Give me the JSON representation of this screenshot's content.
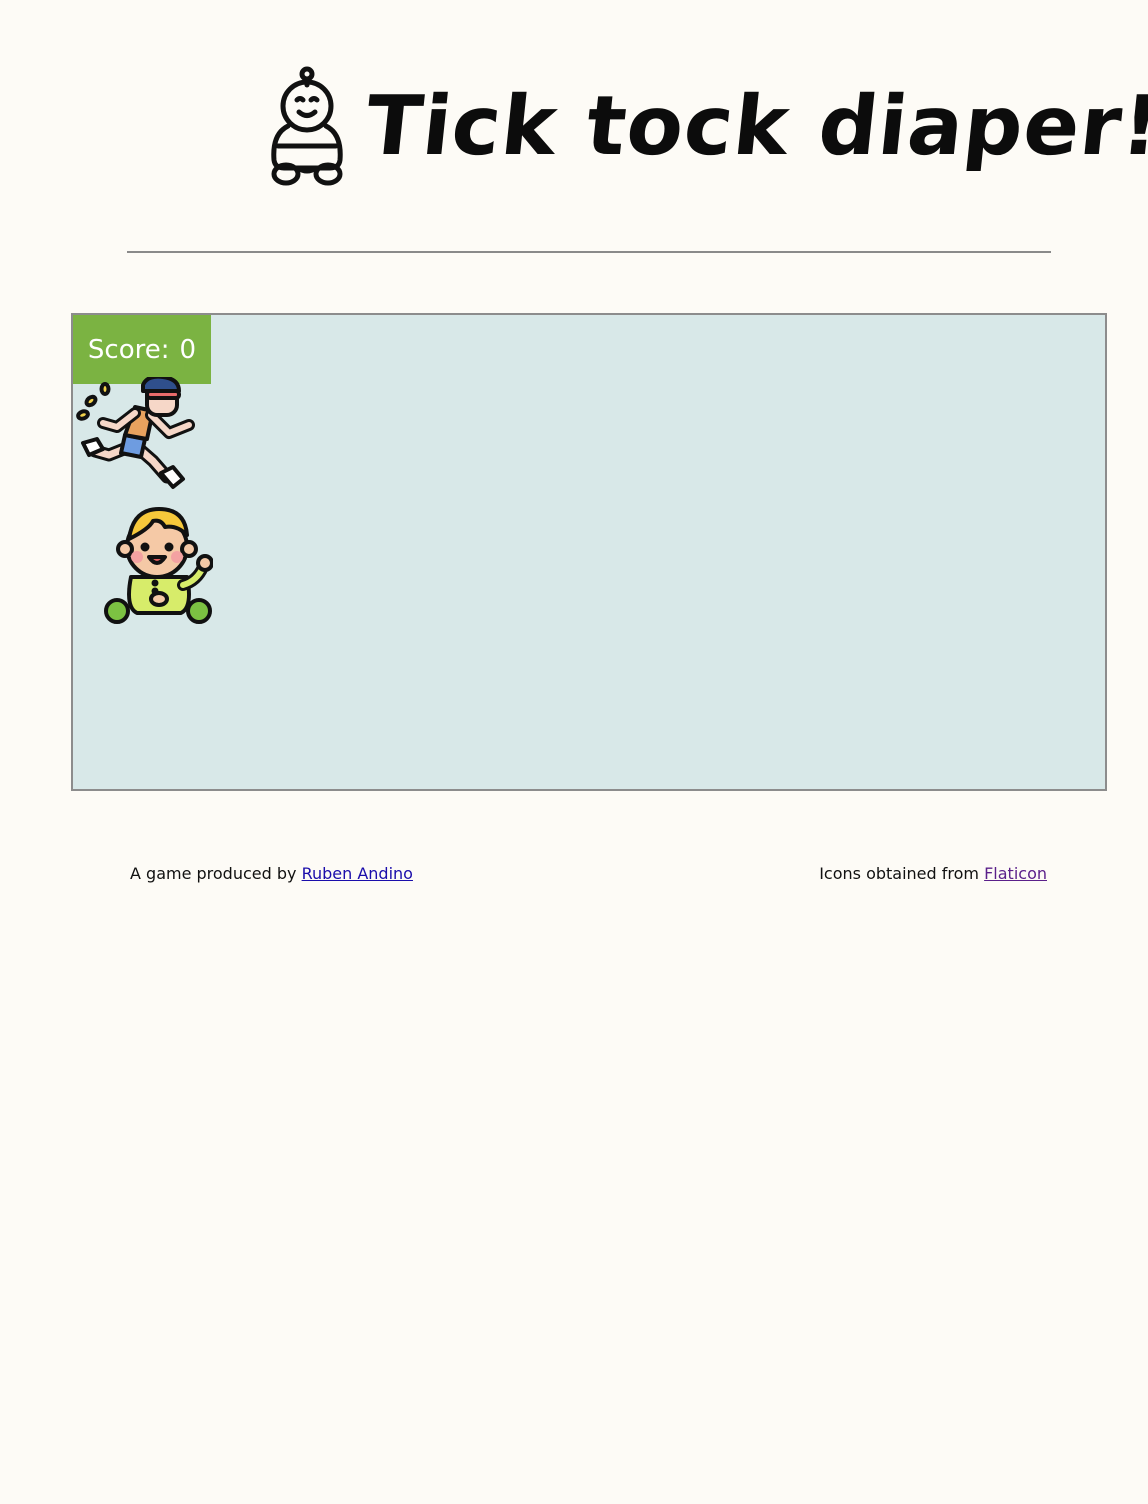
{
  "header": {
    "title": "Tick tock diaper!",
    "logo_icon": "baby-outline-icon"
  },
  "game": {
    "score_label": "Score:",
    "score_value": "0",
    "runner_icon": "running-man-icon",
    "baby_icon": "sitting-baby-icon"
  },
  "footer": {
    "produced_by_text": "A game produced by",
    "author_link": "Ruben Andino",
    "icons_text": "Icons obtained from",
    "icons_link": "Flaticon"
  },
  "colors": {
    "page_background": "#fdfbf6",
    "board_background": "#d8e8e8",
    "score_background": "#7bb342",
    "author_link": "#1a0dab",
    "icons_link": "#5a1f8a"
  }
}
